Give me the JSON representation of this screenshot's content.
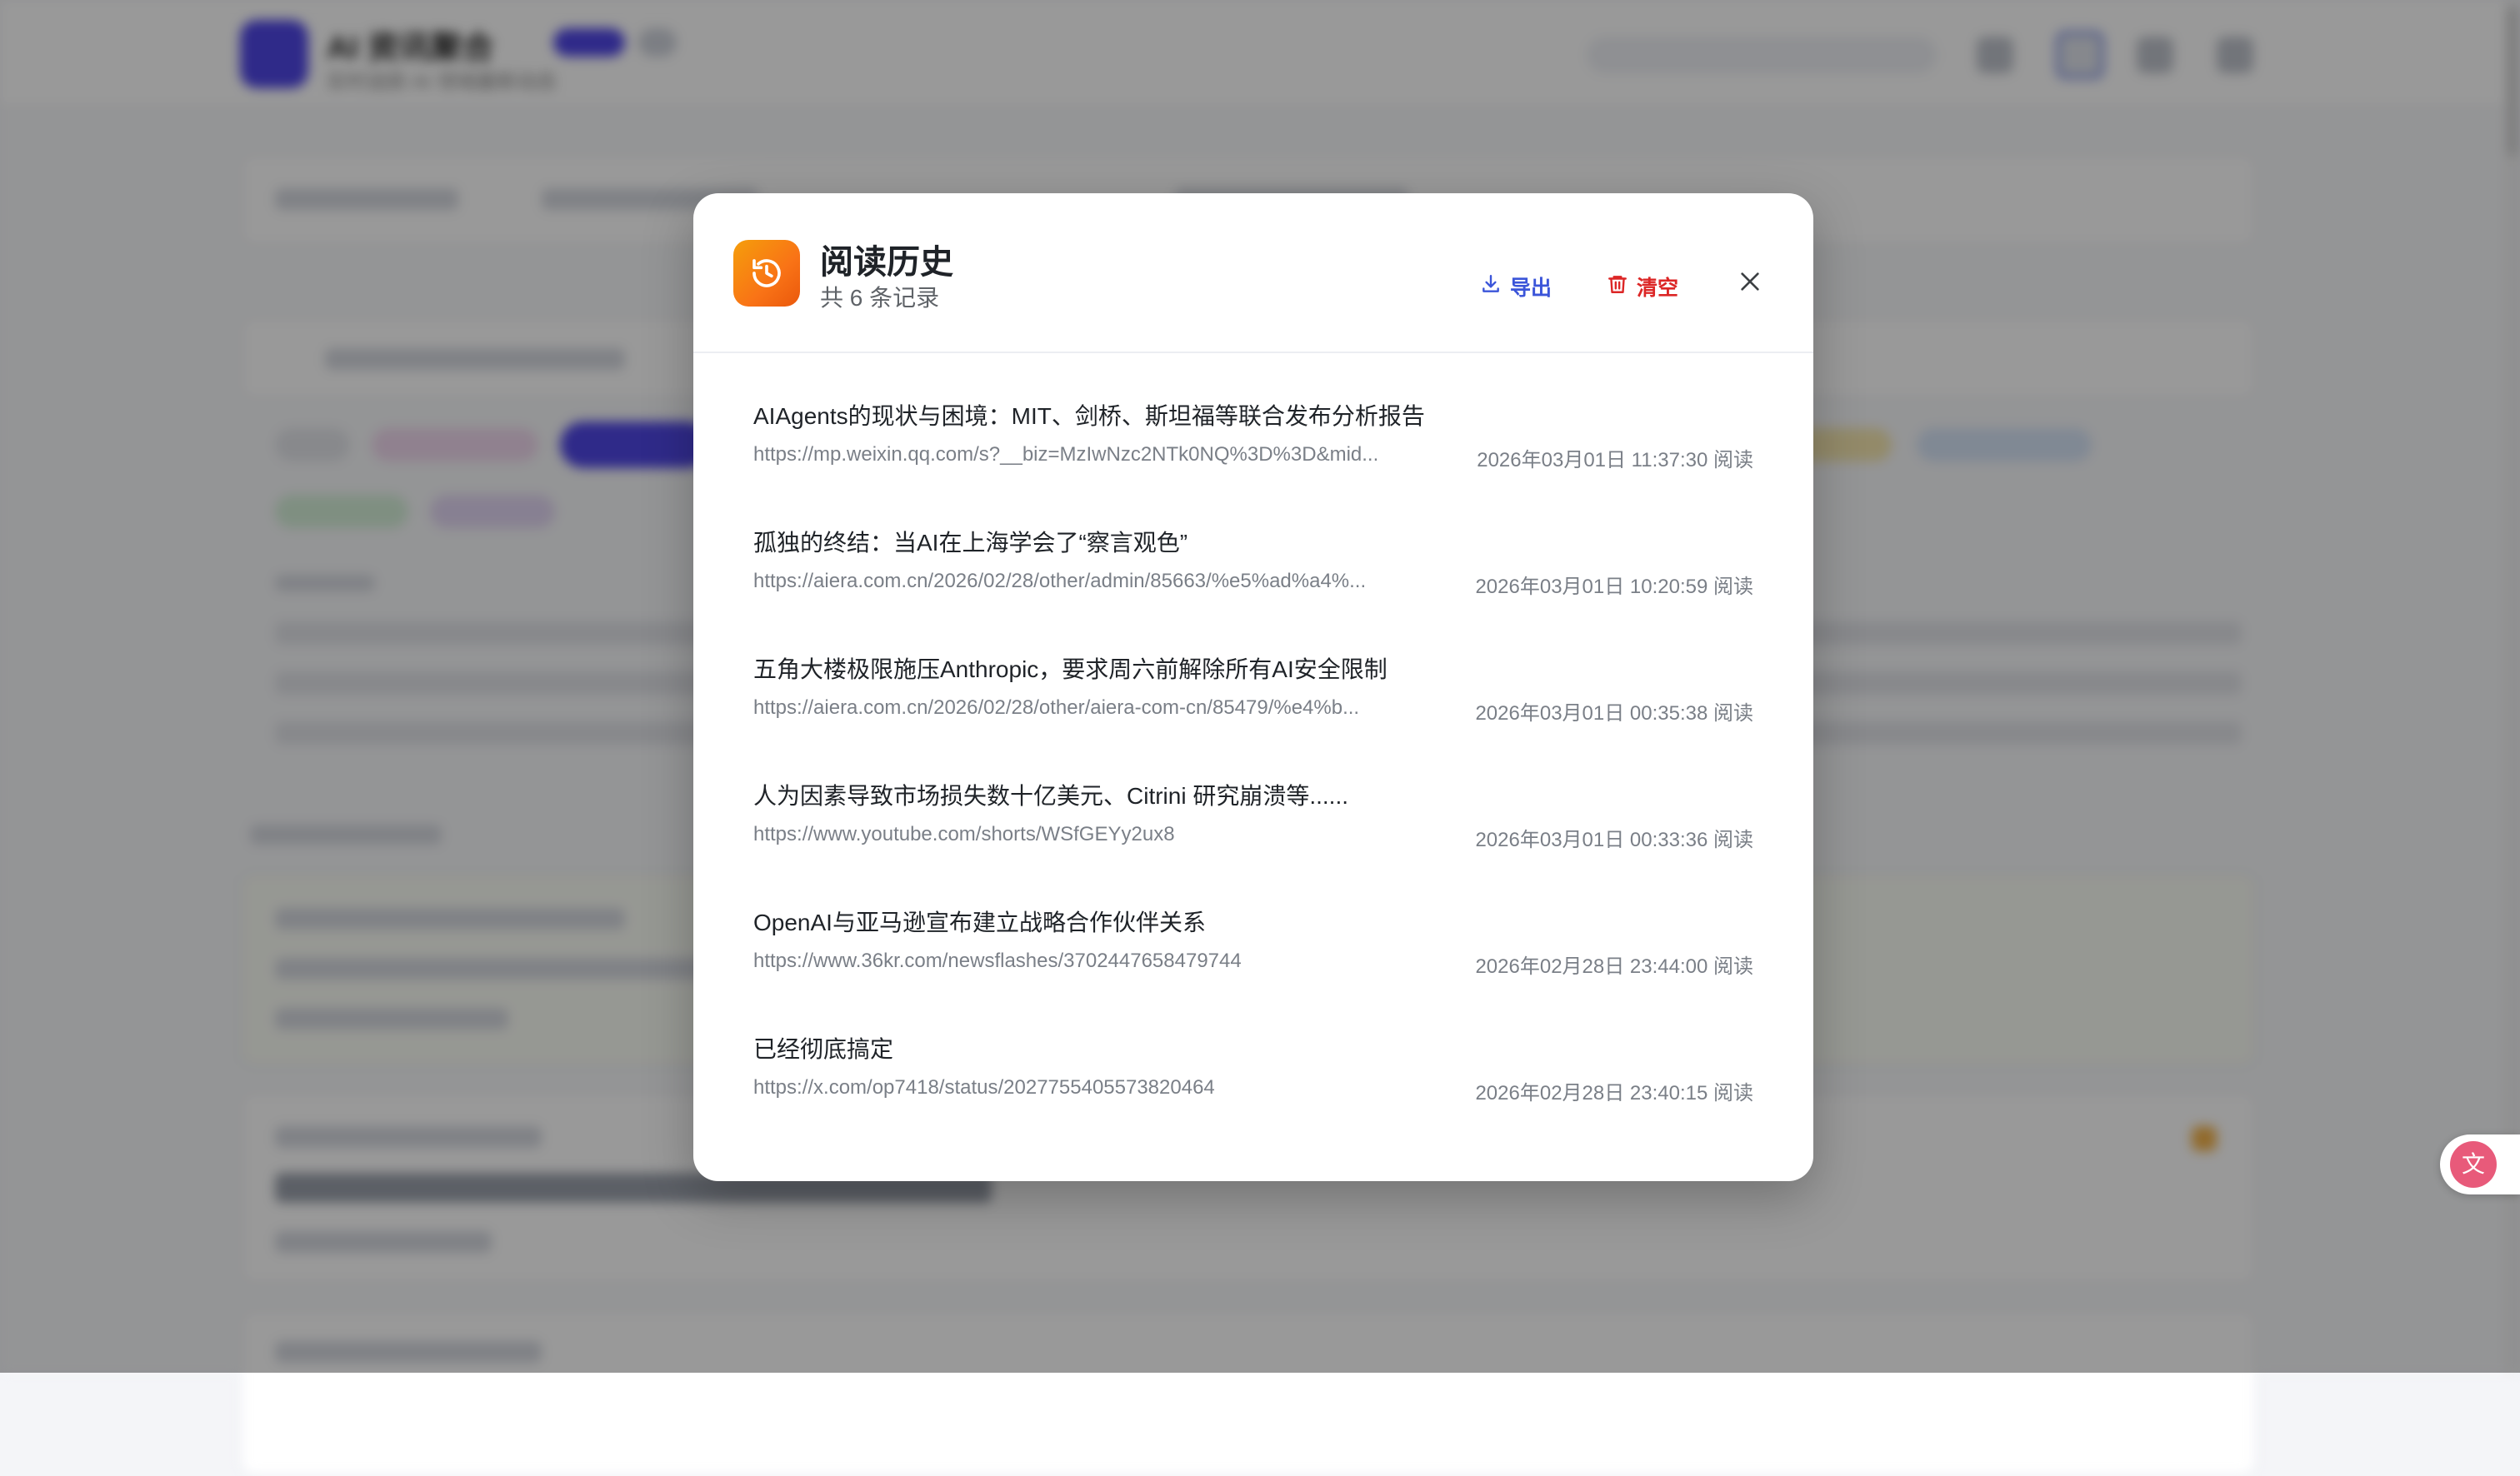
{
  "background": {
    "app_title": "AI 资讯聚合",
    "app_subtitle": "实时追踪 AI 领域最新动态"
  },
  "modal": {
    "title": "阅读历史",
    "count_text": "共 6 条记录",
    "export_label": "导出",
    "clear_label": "清空",
    "icons": {
      "header": "history-icon",
      "export": "download-icon",
      "clear": "trash-icon",
      "close": "close-icon"
    },
    "colors": {
      "accent_orange": "#f97316",
      "export_blue": "#3b55d9",
      "clear_red": "#dc2626"
    },
    "items": [
      {
        "title": "AIAgents的现状与困境：MIT、剑桥、斯坦福等联合发布分析报告",
        "url": "https://mp.weixin.qq.com/s?__biz=MzIwNzc2NTk0NQ%3D%3D&mid...",
        "time": "2026年03月01日 11:37:30 阅读"
      },
      {
        "title": "孤独的终结：当AI在上海学会了“察言观色”",
        "url": "https://aiera.com.cn/2026/02/28/other/admin/85663/%e5%ad%a4%...",
        "time": "2026年03月01日 10:20:59 阅读"
      },
      {
        "title": "五角大楼极限施压Anthropic，要求周六前解除所有AI安全限制",
        "url": "https://aiera.com.cn/2026/02/28/other/aiera-com-cn/85479/%e4%b...",
        "time": "2026年03月01日 00:35:38 阅读"
      },
      {
        "title": "人为因素导致市场损失数十亿美元、Citrini 研究崩溃等......",
        "url": "https://www.youtube.com/shorts/WSfGEYy2ux8",
        "time": "2026年03月01日 00:33:36 阅读"
      },
      {
        "title": "OpenAI与亚马逊宣布建立战略合作伙伴关系",
        "url": "https://www.36kr.com/newsflashes/3702447658479744",
        "time": "2026年02月28日 23:44:00 阅读"
      },
      {
        "title": "已经彻底搞定",
        "url": "https://x.com/op7418/status/2027755405573820464",
        "time": "2026年02月28日 23:40:15 阅读"
      }
    ]
  }
}
